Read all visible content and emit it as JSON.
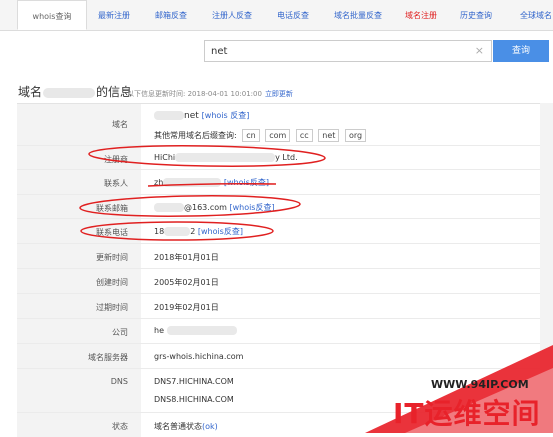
{
  "nav": {
    "tabs": [
      {
        "label": "whois查询",
        "state": "active"
      },
      {
        "label": "最新注册",
        "state": "normal"
      },
      {
        "label": "邮箱反查",
        "state": "normal"
      },
      {
        "label": "注册人反查",
        "state": "normal"
      },
      {
        "label": "电话反查",
        "state": "normal"
      },
      {
        "label": "域名批量反查",
        "state": "normal"
      },
      {
        "label": "域名注册",
        "state": "highlight"
      },
      {
        "label": "历史查询",
        "state": "normal"
      },
      {
        "label": "全球域名",
        "state": "normal"
      }
    ]
  },
  "search": {
    "value": "net",
    "clear_glyph": "×",
    "button": "查询"
  },
  "section": {
    "title_prefix": "域名",
    "title_suffix": "的信息",
    "updated_text": "以下信息更新时间: 2018-04-01 10:01:00",
    "refresh_link": "立即更新"
  },
  "rows": {
    "domain": {
      "label": "域名",
      "value": "net",
      "link": "[whois 反查]",
      "suffix_label": "其他常用域名后缀查询:",
      "suffixes": [
        "cn",
        "com",
        "cc",
        "net",
        "org"
      ]
    },
    "registrar": {
      "label": "注册商",
      "value_start": "HiChi",
      "value_end": "y Ltd."
    },
    "contact": {
      "label": "联系人",
      "value": "zh",
      "link": "[whois反查]"
    },
    "email": {
      "label": "联系邮箱",
      "value": "@163.com",
      "link": "[whois反查]"
    },
    "phone": {
      "label": "联系电话",
      "value": "18",
      "value_end": "2",
      "link": "[whois反查]"
    },
    "updated": {
      "label": "更新时间",
      "value": "2018年01月01日"
    },
    "created": {
      "label": "创建时间",
      "value": "2005年02月01日"
    },
    "expires": {
      "label": "过期时间",
      "value": "2019年02月01日"
    },
    "company": {
      "label": "公司",
      "value": "he"
    },
    "whois_server": {
      "label": "域名服务器",
      "value": "grs-whois.hichina.com"
    },
    "dns": {
      "label": "DNS",
      "values": [
        "DNS7.HICHINA.COM",
        "DNS8.HICHINA.COM"
      ]
    },
    "status": {
      "label": "状态",
      "value": "域名普通状态",
      "status_link": "(ok)"
    }
  },
  "watermark": {
    "url": "WWW.94IP.COM",
    "brand": "IT运维空间"
  },
  "colors": {
    "link": "#3366cc",
    "highlight_tab": "#e02020",
    "button": "#4a8fe6",
    "annotation": "#e02020"
  }
}
